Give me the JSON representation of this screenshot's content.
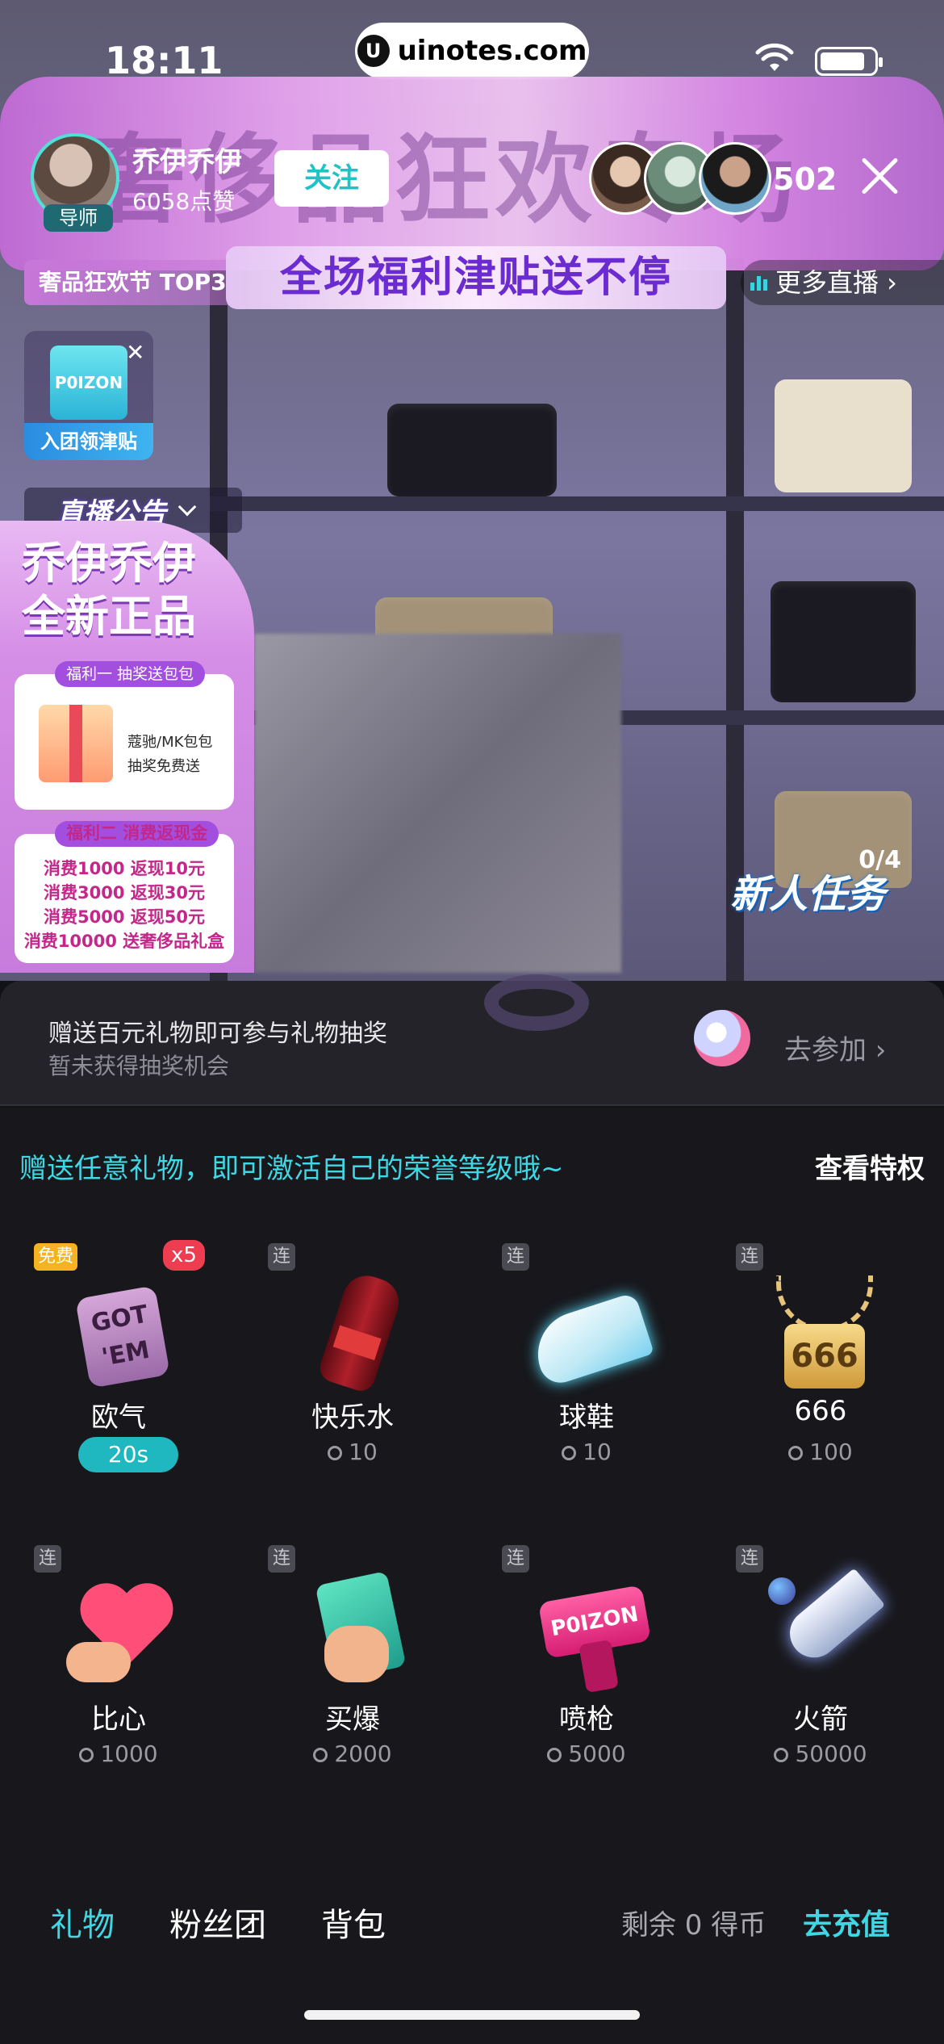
{
  "status_bar": {
    "time": "18:11",
    "site": "uinotes.com",
    "site_logo": "U"
  },
  "banner": {
    "title": "奢侈品狂欢专场",
    "host_name": "乔伊乔伊",
    "host_likes": "6058点赞",
    "host_tag": "导师",
    "follow_label": "关注",
    "viewer_count": "502",
    "rank_tag": "奢品狂欢节 TOP3",
    "promo": "全场福利津贴送不停",
    "more_live": "更多直播 ›"
  },
  "widgets": {
    "fan_box": "P0IZON",
    "fan_label": "入团领津贴",
    "notice_title": "直播公告",
    "notice_shop_line1": "乔伊乔伊",
    "notice_shop_line2": "全新正品",
    "benefit1_tag": "福利一 抽奖送包包",
    "benefit1_text_line1": "蔻驰/MK包包",
    "benefit1_text_line2": "抽奖免费送",
    "benefit2_tag": "福利二 消费返现金",
    "benefit2_lines": [
      "消费1000 返现10元",
      "消费3000 返现30元",
      "消费5000 返现50元",
      "消费10000 送奢侈品礼盒"
    ],
    "task_count": "0/4",
    "task_label": "新人任务"
  },
  "lottery": {
    "title": "赠送百元礼物即可参与礼物抽奖",
    "subtitle": "暂未获得抽奖机会",
    "action": "去参加 ›"
  },
  "panel": {
    "honor_text": "赠送任意礼物，即可激活自己的荣誉等级哦~",
    "privilege_label": "查看特权",
    "gifts": [
      {
        "name": "欧气",
        "flag": "免费",
        "multiplier": "x5",
        "timer": "20s",
        "art": "GOT 'EM"
      },
      {
        "name": "快乐水",
        "flag": "连",
        "price": "10"
      },
      {
        "name": "球鞋",
        "flag": "连",
        "price": "10"
      },
      {
        "name": "666",
        "flag": "连",
        "price": "100",
        "art": "666"
      },
      {
        "name": "比心",
        "flag": "连",
        "price": "1000"
      },
      {
        "name": "买爆",
        "flag": "连",
        "price": "2000"
      },
      {
        "name": "喷枪",
        "flag": "连",
        "price": "5000",
        "art": "P0IZON"
      },
      {
        "name": "火箭",
        "flag": "连",
        "price": "50000"
      }
    ]
  },
  "tabs": {
    "gift": "礼物",
    "fan_club": "粉丝团",
    "backpack": "背包",
    "balance": "剩余 0 得币",
    "recharge": "去充值"
  },
  "colors": {
    "accent": "#3fd7e3",
    "free_flag": "#f6b321",
    "x5_badge": "#ee3d50",
    "timer": "#1fb8c0"
  }
}
